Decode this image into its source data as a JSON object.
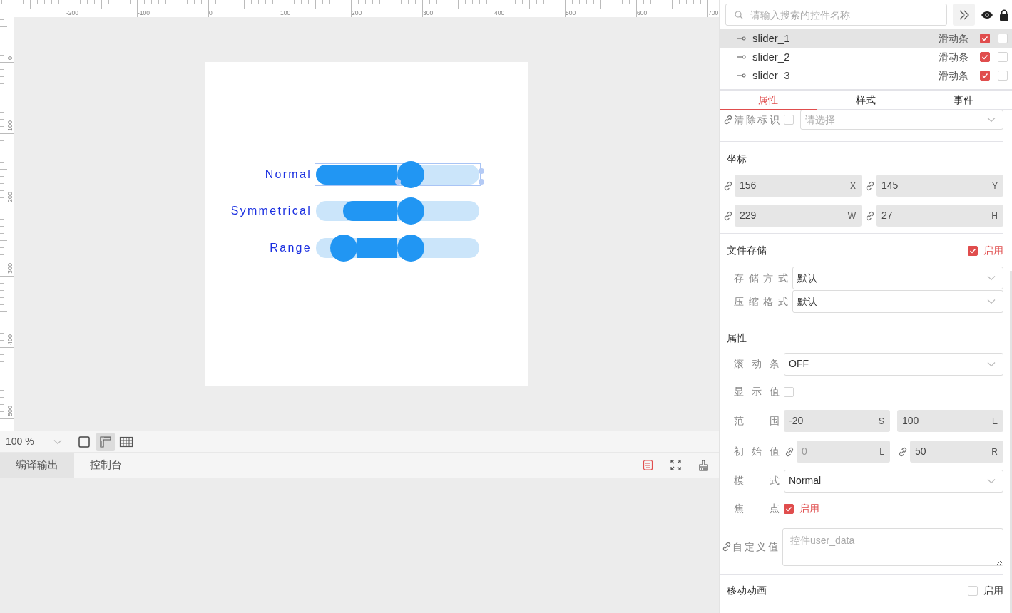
{
  "ruler": {
    "top_labels": [
      "-200",
      "-100",
      "0",
      "100",
      "200",
      "300",
      "400",
      "500",
      "600",
      "700"
    ],
    "left_labels": [
      "0",
      "100",
      "200",
      "300",
      "400",
      "500"
    ]
  },
  "canvas": {
    "sliders": [
      {
        "label": "Normal",
        "kind": "normal",
        "selected": true,
        "value": {
          "level": 0.58
        }
      },
      {
        "label": "Symmetrical",
        "kind": "symmetrical",
        "selected": false,
        "fill": {
          "level": 0.33
        },
        "value": {
          "level": 0.58
        }
      },
      {
        "label": "Range",
        "kind": "range",
        "selected": false,
        "low": {
          "level": 0.17
        },
        "value": {
          "level": 0.58
        }
      }
    ]
  },
  "toolbar": {
    "zoom": "100 %",
    "view_buttons": [
      {
        "kind": "frame",
        "selected": false
      },
      {
        "kind": "ruler",
        "selected": true
      },
      {
        "kind": "grid",
        "selected": false
      }
    ]
  },
  "output_tabs": [
    {
      "label": "编译输出",
      "selected": true
    },
    {
      "label": "控制台",
      "selected": false
    }
  ],
  "panel": {
    "search": {
      "placeholder": "请输入搜索的控件名称"
    },
    "widgets": [
      {
        "name": "slider_1",
        "type": "滑动条",
        "selected": true,
        "visible": true,
        "locked": false
      },
      {
        "name": "slider_2",
        "type": "滑动条",
        "selected": false,
        "visible": true,
        "locked": false
      },
      {
        "name": "slider_3",
        "type": "滑动条",
        "selected": false,
        "visible": true,
        "locked": false
      }
    ],
    "tabs": [
      {
        "label": "属性",
        "selected": true
      },
      {
        "label": "样式",
        "selected": false
      },
      {
        "label": "事件",
        "selected": false
      }
    ],
    "clear_id": {
      "label": "清除标识",
      "checked": false,
      "placeholder": "请选择"
    },
    "coords": {
      "title": "坐标",
      "fields": [
        {
          "value": "156",
          "unit": "X"
        },
        {
          "value": "145",
          "unit": "Y"
        },
        {
          "value": "229",
          "unit": "W"
        },
        {
          "value": "27",
          "unit": "H"
        }
      ]
    },
    "file_storage": {
      "title": "文件存储",
      "enabled": true,
      "enable_label": "启用",
      "rows": [
        {
          "label": "存储方式",
          "value": "默认"
        },
        {
          "label": "压缩格式",
          "value": "默认"
        }
      ]
    },
    "props": {
      "title": "属性",
      "rows": [
        {
          "kind": "select",
          "label": "滚动条",
          "value": "OFF"
        },
        {
          "kind": "checkbox",
          "label": "显示值",
          "checked": false
        },
        {
          "kind": "pair",
          "label": "范围",
          "fields": [
            {
              "value": "-20",
              "unit": "S",
              "linked": false,
              "disabled": false
            },
            {
              "value": "100",
              "unit": "E",
              "linked": false,
              "disabled": false
            }
          ]
        },
        {
          "kind": "pair",
          "label": "初始值",
          "fields": [
            {
              "value": "0",
              "unit": "L",
              "linked": true,
              "disabled": true
            },
            {
              "value": "50",
              "unit": "R",
              "linked": true,
              "disabled": false
            }
          ]
        },
        {
          "kind": "select",
          "label": "模式",
          "value": "Normal"
        },
        {
          "kind": "checkbox",
          "label": "焦点",
          "checked": true,
          "text": "启用"
        },
        {
          "kind": "textarea",
          "label": "自定义值",
          "linked": true,
          "placeholder": "控件user_data"
        }
      ]
    },
    "animation": {
      "title": "移动动画",
      "enabled": false,
      "enable_label": "启用"
    }
  }
}
